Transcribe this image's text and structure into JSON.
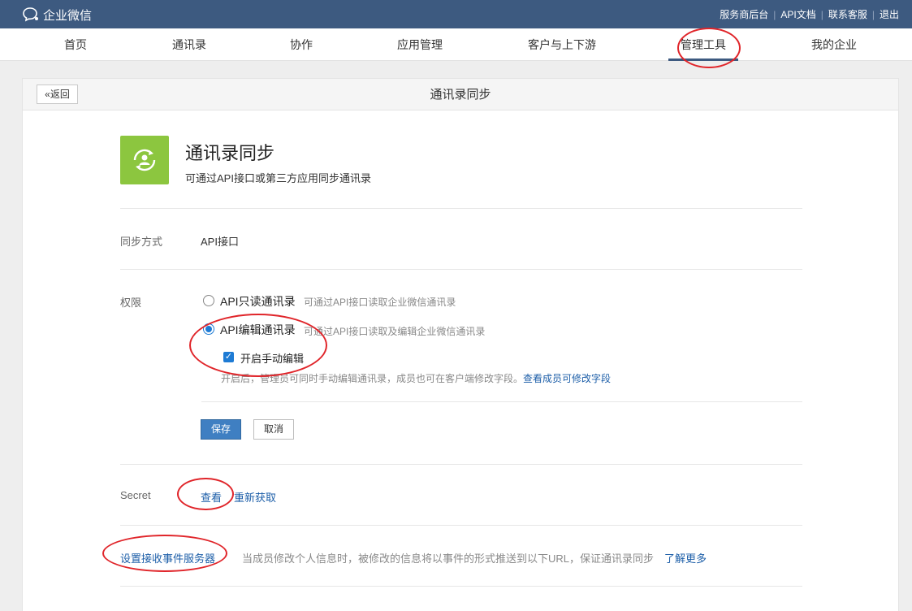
{
  "topbar": {
    "logo_text": "企业微信",
    "links": [
      "服务商后台",
      "API文档",
      "联系客服",
      "退出"
    ],
    "separator": "|"
  },
  "nav": {
    "items": [
      "首页",
      "通讯录",
      "协作",
      "应用管理",
      "客户与上下游",
      "管理工具",
      "我的企业"
    ],
    "active": "管理工具"
  },
  "card": {
    "back_label": "返回",
    "title": "通讯录同步"
  },
  "app": {
    "name": "通讯录同步",
    "description": "可通过API接口或第三方应用同步通讯录",
    "icon": "sync-user-icon",
    "icon_color": "#8cc63f"
  },
  "sync_method": {
    "label": "同步方式",
    "value": "API接口"
  },
  "permission": {
    "label": "权限",
    "options": [
      {
        "label": "API只读通讯录",
        "desc": "可通过API接口读取企业微信通讯录",
        "selected": false
      },
      {
        "label": "API编辑通讯录",
        "desc": "可通过API接口读取及编辑企业微信通讯录",
        "selected": true
      }
    ],
    "manual_edit": {
      "label": "开启手动编辑",
      "checked": true,
      "hint": "开启后，管理员可同时手动编辑通讯录，成员也可在客户端修改字段。",
      "hint_link": "查看成员可修改字段"
    },
    "save_label": "保存",
    "cancel_label": "取消"
  },
  "secret": {
    "label": "Secret",
    "view_label": "查看",
    "refresh_label": "重新获取"
  },
  "event_server": {
    "link_label": "设置接收事件服务器",
    "desc": "当成员修改个人信息时，被修改的信息将以事件的形式推送到以下URL，保证通讯录同步",
    "more_label": "了解更多"
  },
  "colors": {
    "topbar": "#3d5a80",
    "accent": "#1e7bd4",
    "link": "#1c5ea8",
    "annotation": "#e0252a"
  }
}
